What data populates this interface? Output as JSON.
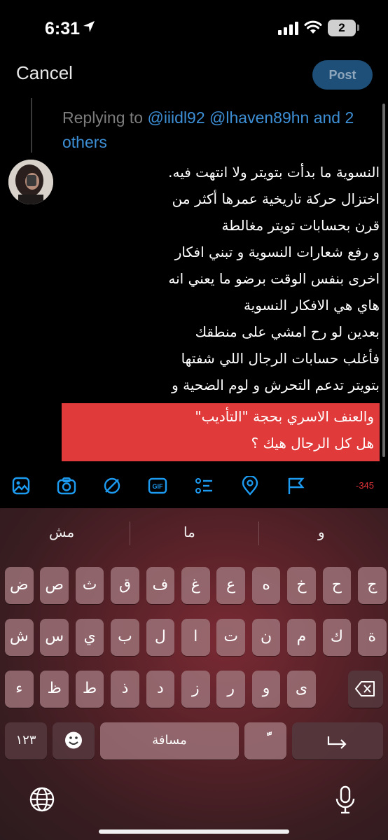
{
  "status_bar": {
    "time": "6:31",
    "battery": "2",
    "icons": [
      "location-arrow-icon",
      "signal-icon",
      "wifi-icon",
      "battery-icon"
    ]
  },
  "compose": {
    "cancel_label": "Cancel",
    "post_label": "Post",
    "replying_prefix": "Replying to ",
    "mention_1": "@iiidl92",
    "mention_2": "@lhaven89hn",
    "and_word": "and",
    "others": "2 others",
    "tweet_lines": [
      "النسوية ما بدأت بتويتر ولا انتهت فيه.",
      "اختزال حركة تاريخية عمرها أكثر من",
      "قرن بحسابات تويتر مغالطة",
      "و رفع شعارات النسوية و تبني افكار",
      "اخرى بنفس الوقت برضو ما يعني انه",
      "هاي هي الافكار النسوية",
      "بعدين لو رح امشي على منطقك",
      "فأغلب حسابات الرجال اللي شفتها",
      "بتويتر تدعم التحرش و لوم الضحية و"
    ],
    "over_limit_lines": [
      "والعنف الاسري بحجة \"التأديب\"",
      "هل كل الرجال هيك ؟"
    ],
    "char_count": "-345",
    "accent_color": "#1d9bf0",
    "over_limit_color": "#e03a3a"
  },
  "toolbar": {
    "icons": [
      "image-icon",
      "camera-icon",
      "no-sign-icon",
      "gif-icon",
      "poll-icon",
      "location-pin-icon",
      "flag-icon"
    ],
    "gif_label": "GIF"
  },
  "keyboard": {
    "suggestions": [
      "مش",
      "ما",
      "و"
    ],
    "row1": [
      "ض",
      "ص",
      "ث",
      "ق",
      "ف",
      "غ",
      "ع",
      "ه",
      "خ",
      "ح",
      "ج"
    ],
    "row2": [
      "ش",
      "س",
      "ي",
      "ب",
      "ل",
      "ا",
      "ت",
      "ن",
      "م",
      "ك",
      "ة"
    ],
    "row3": [
      "ء",
      "ظ",
      "ط",
      "ذ",
      "د",
      "ز",
      "ر",
      "و",
      "ى"
    ],
    "numbers_label": "١٢٣",
    "space_label": "مسافة",
    "diacritic_label": "ًّ"
  }
}
